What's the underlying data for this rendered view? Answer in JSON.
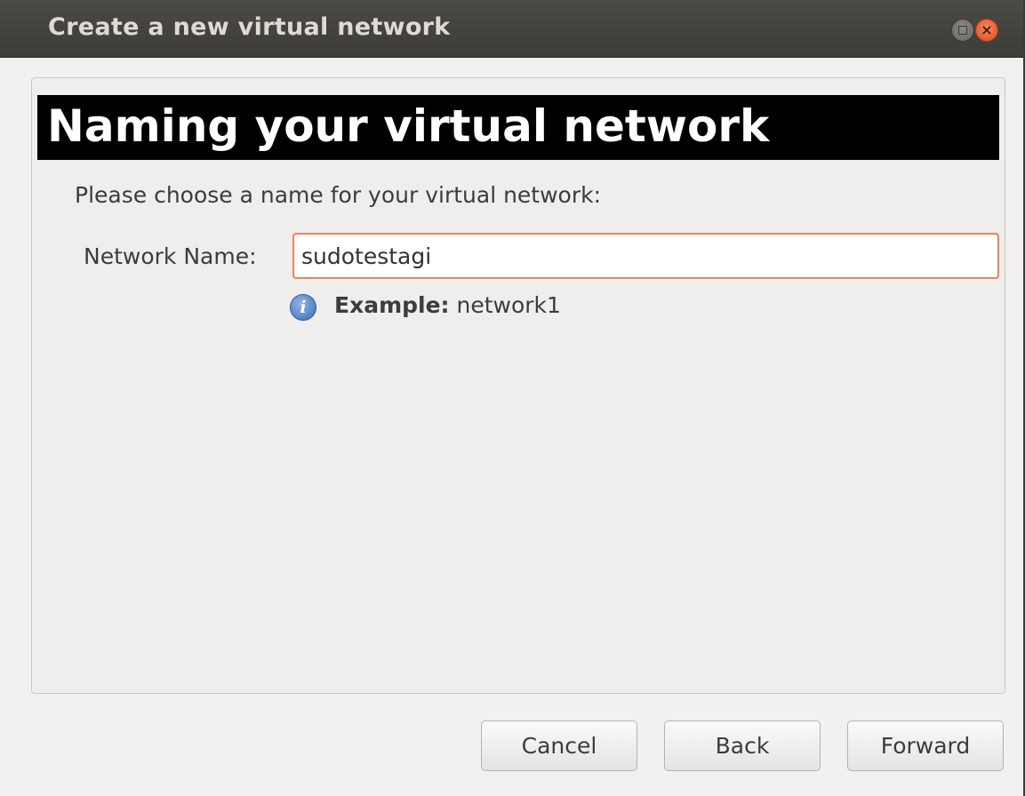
{
  "window": {
    "title": "Create a new virtual network",
    "maximize_icon": "maximize-icon",
    "close_icon": "close-icon",
    "close_glyph": "×"
  },
  "header": {
    "title": "Naming your virtual network"
  },
  "form": {
    "prompt": "Please choose a name for your virtual network:",
    "network_name_label": "Network Name:",
    "network_name_value": "sudotestagi",
    "info_icon": "info-icon",
    "info_glyph": "i",
    "example_label": "Example:",
    "example_value": " network1"
  },
  "buttons": {
    "cancel": "Cancel",
    "back": "Back",
    "forward": "Forward"
  },
  "colors": {
    "title_bar": "#3d3c38",
    "header_bg": "#000000",
    "input_focus_border": "#e8885a",
    "close_button": "#df4a1a",
    "info_icon": "#3c6fb6"
  }
}
